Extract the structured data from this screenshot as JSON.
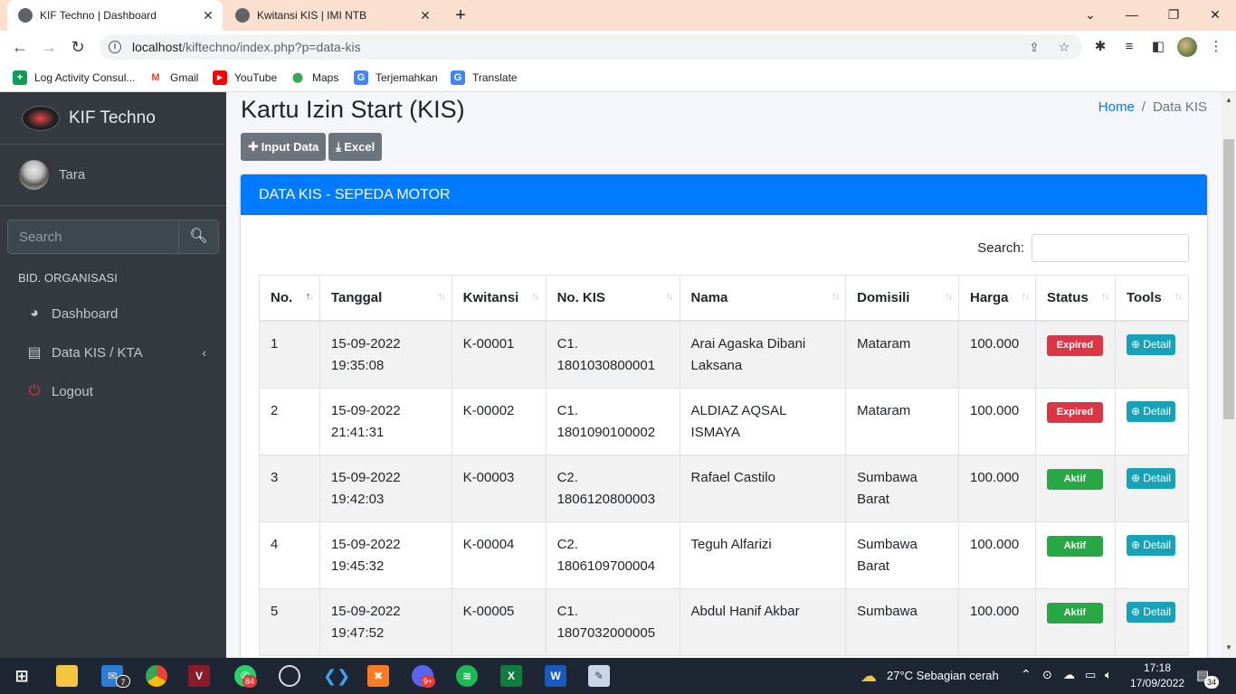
{
  "browser": {
    "tabs": [
      {
        "title": "KIF Techno | Dashboard",
        "active": true
      },
      {
        "title": "Kwitansi KIS | IMI NTB",
        "active": false
      }
    ],
    "url_host": "localhost",
    "url_path": "/kiftechno/index.php?p=data-kis",
    "bookmarks": [
      "Log Activity Consul...",
      "Gmail",
      "YouTube",
      "Maps",
      "Terjemahkan",
      "Translate"
    ]
  },
  "sidebar": {
    "brand": "KIF Techno",
    "user": "Tara",
    "search_placeholder": "Search",
    "section": "BID. ORGANISASI",
    "items": [
      {
        "label": "Dashboard",
        "icon": "dashboard-icon"
      },
      {
        "label": "Data KIS / KTA",
        "icon": "book-icon"
      },
      {
        "label": "Logout",
        "icon": "power-icon"
      }
    ]
  },
  "page": {
    "title": "Kartu Izin Start (KIS)",
    "breadcrumb_home": "Home",
    "breadcrumb_sep": "/",
    "breadcrumb_current": "Data KIS",
    "btn_input": "Input Data",
    "btn_excel": "Excel",
    "card_title": "DATA KIS - SEPEDA MOTOR",
    "search_label": "Search:"
  },
  "table": {
    "headers": [
      "No.",
      "Tanggal",
      "Kwitansi",
      "No. KIS",
      "Nama",
      "Domisili",
      "Harga",
      "Status",
      "Tools"
    ],
    "rows": [
      {
        "no": "1",
        "tgl": "15-09-2022",
        "jam": "19:35:08",
        "kw": "K-00001",
        "kis1": "C1.",
        "kis2": "1801030800001",
        "nama": "Arai Agaska Dibani Laksana",
        "dom": "Mataram",
        "harga": "100.000",
        "status": "Expired",
        "tools": "Detail"
      },
      {
        "no": "2",
        "tgl": "15-09-2022",
        "jam": "21:41:31",
        "kw": "K-00002",
        "kis1": "C1.",
        "kis2": "1801090100002",
        "nama": "ALDIAZ AQSAL ISMAYA",
        "dom": "Mataram",
        "harga": "100.000",
        "status": "Expired",
        "tools": "Detail"
      },
      {
        "no": "3",
        "tgl": "15-09-2022",
        "jam": "19:42:03",
        "kw": "K-00003",
        "kis1": "C2.",
        "kis2": "1806120800003",
        "nama": "Rafael Castilo",
        "dom": "Sumbawa Barat",
        "harga": "100.000",
        "status": "Aktif",
        "tools": "Detail"
      },
      {
        "no": "4",
        "tgl": "15-09-2022",
        "jam": "19:45:32",
        "kw": "K-00004",
        "kis1": "C2.",
        "kis2": "1806109700004",
        "nama": "Teguh Alfarizi",
        "dom": "Sumbawa Barat",
        "harga": "100.000",
        "status": "Aktif",
        "tools": "Detail"
      },
      {
        "no": "5",
        "tgl": "15-09-2022",
        "jam": "19:47:52",
        "kw": "K-00005",
        "kis1": "C1.",
        "kis2": "1807032000005",
        "nama": "Abdul Hanif Akbar",
        "dom": "Sumbawa",
        "harga": "100.000",
        "status": "Aktif",
        "tools": "Detail"
      }
    ]
  },
  "taskbar": {
    "weather": "27°C  Sebagian cerah",
    "time": "17:18",
    "date": "17/09/2022",
    "mail_badge": "7",
    "whatsapp_badge": "84",
    "notif_count": "34",
    "chat_badge": "9+"
  }
}
